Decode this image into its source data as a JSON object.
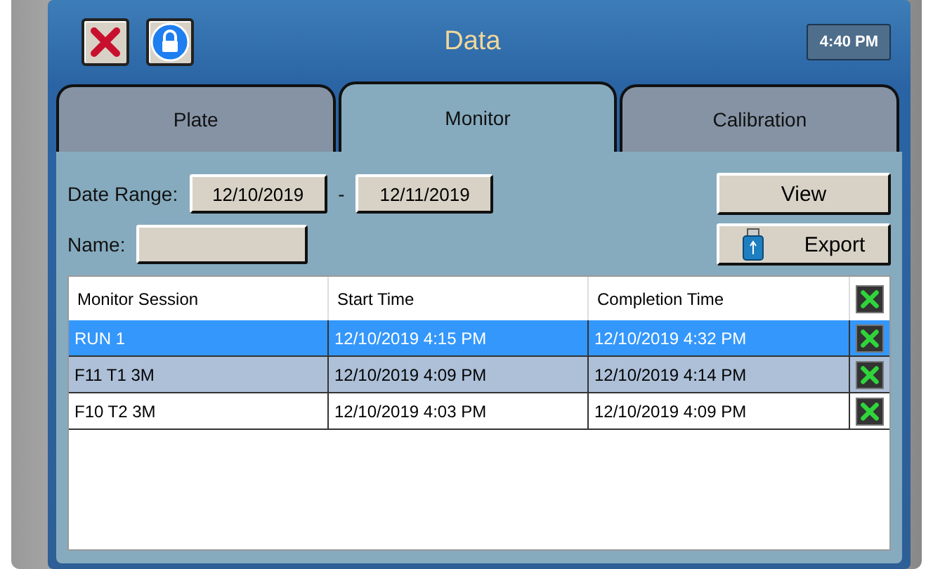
{
  "header": {
    "title": "Data",
    "clock": "4:40 PM"
  },
  "tabs": [
    {
      "label": "Plate",
      "selected": false
    },
    {
      "label": "Monitor",
      "selected": true
    },
    {
      "label": "Calibration",
      "selected": false
    }
  ],
  "filters": {
    "date_range_label": "Date Range:",
    "date_from": "12/10/2019",
    "separator": "-",
    "date_to": "12/11/2019",
    "name_label": "Name:"
  },
  "buttons": {
    "view": "View",
    "export": "Export"
  },
  "table": {
    "columns": [
      "Monitor Session",
      "Start Time",
      "Completion Time"
    ],
    "rows": [
      {
        "cells": [
          "RUN 1",
          "12/10/2019 4:15 PM",
          "12/10/2019 4:32 PM"
        ],
        "selected": true
      },
      {
        "cells": [
          "F11 T1 3M",
          "12/10/2019 4:09 PM",
          "12/10/2019 4:14 PM"
        ],
        "selected": false
      },
      {
        "cells": [
          "F10 T2 3M",
          "12/10/2019 4:03 PM",
          "12/10/2019 4:09 PM"
        ],
        "selected": false
      }
    ]
  }
}
